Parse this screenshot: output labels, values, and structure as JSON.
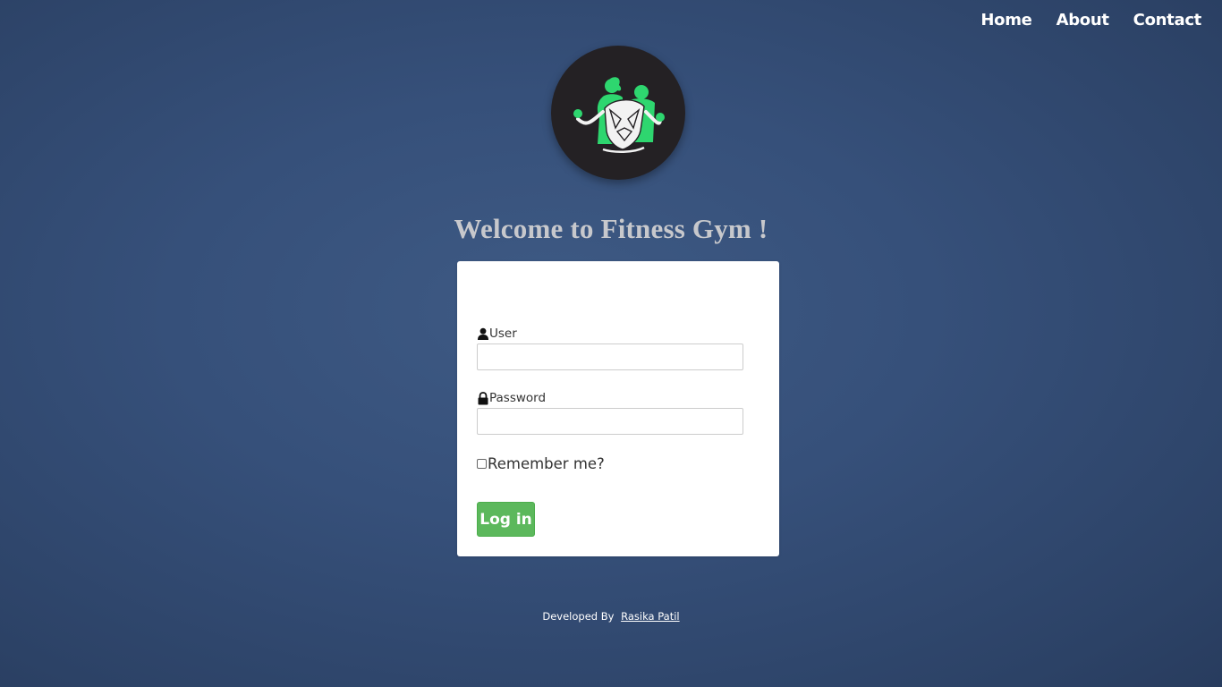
{
  "nav": {
    "items": [
      "Home",
      "About",
      "Contact"
    ]
  },
  "logo": {
    "icon": "fitness-couple-logo",
    "accent_color": "#2ed66f",
    "bg_color": "#242124"
  },
  "heading": "Welcome to Fitness Gym !",
  "form": {
    "user_label": "User",
    "user_icon": "user-icon",
    "user_value": "",
    "password_label": "Password",
    "password_icon": "lock-icon",
    "password_value": "",
    "remember_label": "Remember me?",
    "remember_checked": false,
    "login_label": "Log in",
    "login_color": "#5cb85c"
  },
  "footer": {
    "prefix": "Developed By",
    "author": "Rasika Patil"
  }
}
